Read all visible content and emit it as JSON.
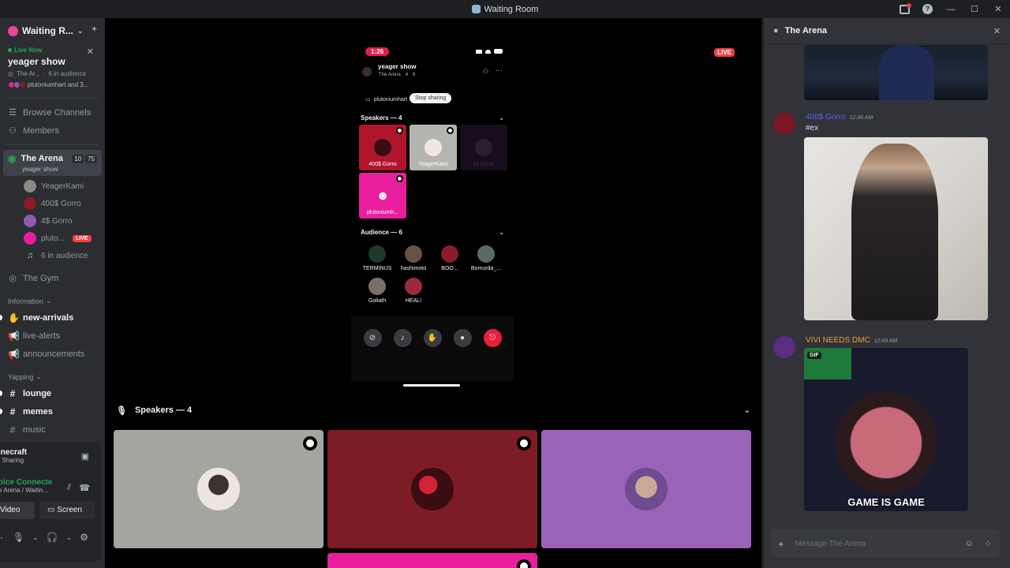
{
  "window": {
    "title": "Waiting Room"
  },
  "sidebar": {
    "server_name": "Waiting R...",
    "live_card": {
      "live_label": "Live Now",
      "title": "yeager show",
      "channel": "The Ar...",
      "audience": "6 in audience",
      "sharing": "plutoniumhart and 3..."
    },
    "nav": [
      {
        "label": "Browse Channels",
        "icon": "browse-icon"
      },
      {
        "label": "Members",
        "icon": "members-icon"
      }
    ],
    "stage": {
      "name": "The Arena",
      "count_a": "10",
      "count_b": "75",
      "topic": "yeager show",
      "users": [
        {
          "name": "YeagerKami",
          "color": "#8a8a86"
        },
        {
          "name": "400$ Gorro",
          "color": "#8b1c24"
        },
        {
          "name": "4$ Gorro",
          "color": "#8e5bb0"
        },
        {
          "name": "pluto...",
          "color": "#e91e9e",
          "live": "LIVE"
        }
      ],
      "audience": "6 in audience"
    },
    "other_voice": "The Gym",
    "categories": [
      {
        "label": "Information",
        "channels": [
          {
            "name": "new-arrivals",
            "unread": true,
            "icon": "wave-icon"
          },
          {
            "name": "live-alerts",
            "unread": false,
            "icon": "announce-icon"
          },
          {
            "name": "announcements",
            "unread": false,
            "icon": "announce-icon"
          }
        ]
      },
      {
        "label": "Yapping",
        "channels": [
          {
            "name": "lounge",
            "unread": true,
            "icon": "hash-icon"
          },
          {
            "name": "memes",
            "unread": true,
            "icon": "hash-icon"
          },
          {
            "name": "music",
            "unread": false,
            "icon": "hash-icon"
          }
        ]
      }
    ],
    "activity": {
      "name": "inecraft",
      "status": "t Sharing"
    },
    "voice": {
      "status": "oice Connecte",
      "location": "e Arena / Waitin..."
    },
    "buttons": {
      "video": "Video",
      "screen": "Screen"
    }
  },
  "stream": {
    "live": "LIVE",
    "phone": {
      "time": "1:26",
      "title": "yeager show",
      "channel": "The Arena",
      "speakers_count": "4",
      "audience_count": "6",
      "sharing_user": "plutoniumhart",
      "tooltip": "Stop sharing",
      "speakers_header": "Speakers — 4",
      "speakers": [
        {
          "name": "400$ Gorro",
          "bg": "#b0152c",
          "avatar": "#3a0d12"
        },
        {
          "name": "YeagerKami",
          "bg": "#b5b5b0",
          "avatar": "#efe8e0"
        },
        {
          "name": "4$ Gorro",
          "bg": "#170d1c",
          "avatar": "#2c1d33",
          "dim": true
        },
        {
          "name": "plutoniumh...",
          "bg": "#e91e9e",
          "avatar": "#e91e9e"
        }
      ],
      "audience_header": "Audience — 6",
      "audience": [
        {
          "name": "TERMINUS",
          "color": "#1f3a2c"
        },
        {
          "name": "hashimoto",
          "color": "#6a5148"
        },
        {
          "name": "BOO...",
          "color": "#8a1c2c"
        },
        {
          "name": "Bomurda_...",
          "color": "#5a6a62"
        },
        {
          "name": "Goliath",
          "color": "#7a6f68"
        },
        {
          "name": "HEAL!",
          "color": "#9a2a3c"
        }
      ]
    }
  },
  "speakers_bar": {
    "header": "Speakers — 4",
    "tiles": [
      {
        "name": "YeagerKami",
        "color": "#a5a59f",
        "avatar": "#ece6de"
      },
      {
        "name": "400$ Gorro",
        "color": "#7d1c24",
        "avatar": "#3a0d12"
      },
      {
        "name": "4$ Gorro",
        "color": "#9b63b7",
        "avatar": "#d6c5d9"
      }
    ],
    "partial_tile_color": "#e91e9e"
  },
  "chat": {
    "title": "The Arena",
    "messages": [
      {
        "author": "400$ Gorro",
        "color": "#5865f2",
        "time": "12:48 AM",
        "text": "#ex",
        "avatar": "#7a1822"
      },
      {
        "author": "VIVI NEEDS DMC",
        "color": "#e8a23b",
        "time": "12:49 AM",
        "text": "",
        "avatar": "#5a2d80"
      }
    ],
    "gif_badge": "GIF",
    "gif_caption": "GAME IS GAME",
    "composer_placeholder": "Message The Arena"
  }
}
